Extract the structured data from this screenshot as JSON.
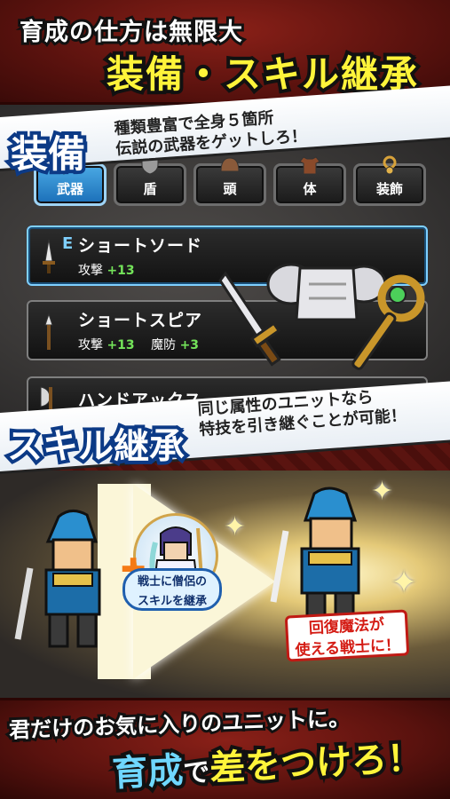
{
  "header": {
    "tagline": "育成の仕方は無限大",
    "headline": "装備・スキル継承"
  },
  "equip_section": {
    "badge": "装備",
    "description_lines": [
      "種類豊富で全身５箇所",
      "伝説の武器をゲットしろ！"
    ],
    "tabs": [
      {
        "label": "武器",
        "icon": "sword-icon",
        "active": true
      },
      {
        "label": "盾",
        "icon": "shield-icon",
        "active": false
      },
      {
        "label": "頭",
        "icon": "helmet-icon",
        "active": false
      },
      {
        "label": "体",
        "icon": "armor-icon",
        "active": false
      },
      {
        "label": "装飾",
        "icon": "amulet-icon",
        "active": false
      }
    ],
    "items": [
      {
        "equipped_mark": "E",
        "name": "ショートソード",
        "stats": [
          {
            "label": "攻撃",
            "value": "+13"
          }
        ]
      },
      {
        "equipped_mark": "",
        "name": "ショートスピア",
        "stats": [
          {
            "label": "攻撃",
            "value": "+13"
          },
          {
            "label": "魔防",
            "value": "+3"
          }
        ]
      },
      {
        "equipped_mark": "",
        "name": "ハンドアックス",
        "stats": []
      }
    ]
  },
  "skill_section": {
    "badge": "スキル継承",
    "description_lines": [
      "同じ属性のユニットなら",
      "特技を引き継ぐことが可能！"
    ],
    "bubble_lines": [
      "戦士に僧侶の",
      "スキルを継承"
    ],
    "result_lines": [
      "回復魔法が",
      "使える戦士に！"
    ]
  },
  "footer": {
    "line1": "君だけのお気に入りのユニットに。",
    "line2_parts": [
      "育成",
      "で",
      "差をつけろ！"
    ]
  },
  "colors": {
    "banner_red": "#5a120e",
    "headline_yellow": "#fff43a",
    "badge_blue": "#0c3a86",
    "stat_green": "#74e45a",
    "accent_cyan": "#6fd7ff"
  }
}
